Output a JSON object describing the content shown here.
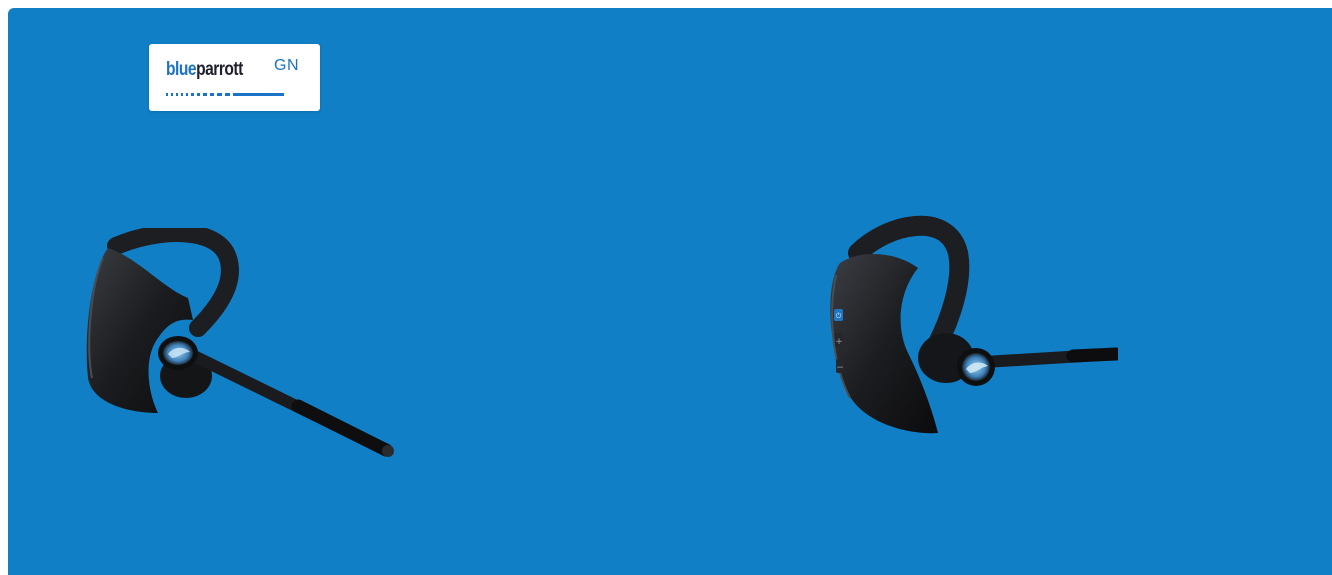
{
  "banner": {
    "background_color": "#107fc6"
  },
  "logo": {
    "word_blue": "blue",
    "word_parrott": "parrott",
    "gn": "GN"
  },
  "products": [
    {
      "name": "headset-left-view",
      "icon": "bluetooth-headset"
    },
    {
      "name": "headset-front-view",
      "icon": "bluetooth-headset"
    }
  ]
}
